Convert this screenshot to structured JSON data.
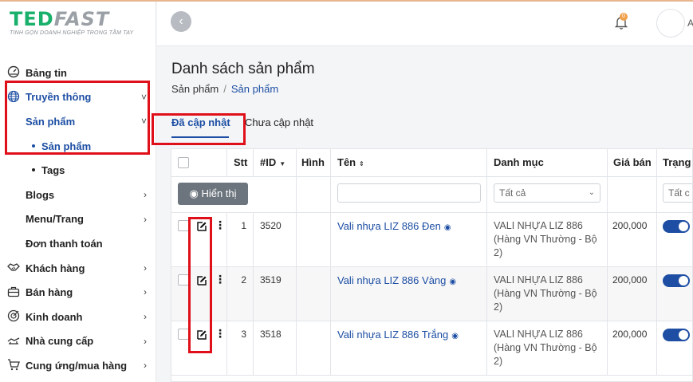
{
  "brand": {
    "name_a": "TED",
    "name_b": "FAST",
    "slogan": "TINH GỌN DOANH NGHIỆP TRONG TẦM TAY"
  },
  "sidebar": {
    "items": [
      {
        "label": "Bảng tin",
        "icon": "dashboard-icon"
      },
      {
        "label": "Truyền thông",
        "icon": "globe-icon",
        "chevron": "˅"
      },
      {
        "label": "Sản phẩm",
        "chevron": "˅"
      },
      {
        "label": "Sản phẩm"
      },
      {
        "label": "Tags"
      },
      {
        "label": "Blogs",
        "chevron": "›"
      },
      {
        "label": "Menu/Trang",
        "chevron": "›"
      },
      {
        "label": "Đơn thanh toán"
      },
      {
        "label": "Khách hàng",
        "icon": "handshake-icon",
        "chevron": "›"
      },
      {
        "label": "Bán hàng",
        "icon": "briefcase-icon",
        "chevron": "›"
      },
      {
        "label": "Kinh doanh",
        "icon": "chart-icon",
        "chevron": "›"
      },
      {
        "label": "Nhà cung cấp",
        "icon": "supplier-icon",
        "chevron": "›"
      },
      {
        "label": "Cung ứng/mua hàng",
        "icon": "cart-icon",
        "chevron": "›"
      }
    ]
  },
  "header": {
    "notification_count": "0",
    "avatar_letter": "A"
  },
  "page": {
    "title": "Danh sách sản phẩm",
    "breadcrumb": [
      "Sản phẩm",
      "/",
      "Sản phẩm"
    ],
    "tabs": [
      "Đã cập nhật",
      "Chưa cập nhật"
    ]
  },
  "table": {
    "headers": {
      "stt": "Stt",
      "id": "#ID",
      "image": "Hình",
      "name": "Tên",
      "category": "Danh mục",
      "price": "Giá bán",
      "status": "Trạng"
    },
    "filter": {
      "show_button": "Hiển thị",
      "category_value": "Tất cả",
      "status_value": "Tất c"
    },
    "rows": [
      {
        "stt": "1",
        "id": "3520",
        "name": "Vali nhựa LIZ 886 Đen",
        "category": "VALI NHỰA LIZ 886 (Hàng VN Thường - Bộ 2)",
        "price": "200,000"
      },
      {
        "stt": "2",
        "id": "3519",
        "name": "Vali nhựa LIZ 886 Vàng",
        "category": "VALI NHỰA LIZ 886 (Hàng VN Thường - Bộ 2)",
        "price": "200,000"
      },
      {
        "stt": "3",
        "id": "3518",
        "name": "Vali nhựa LIZ 886 Trắng",
        "category": "VALI NHỰA LIZ 886 (Hàng VN Thường - Bộ 2)",
        "price": "200,000"
      }
    ]
  },
  "colors": {
    "accent": "#1d4ea3",
    "highlight": "#e0101a",
    "brand_green": "#18b06a"
  }
}
